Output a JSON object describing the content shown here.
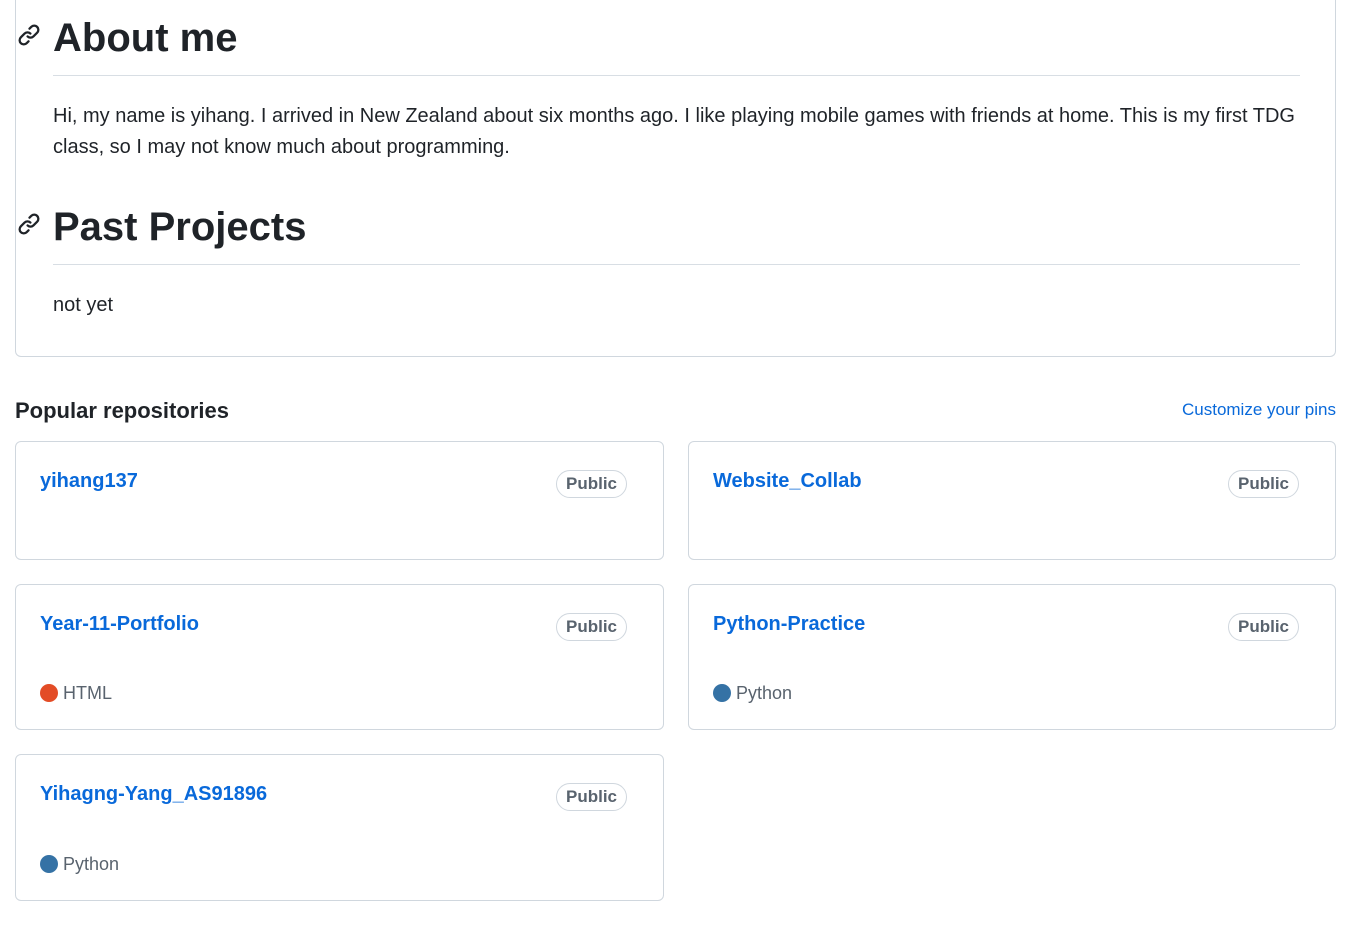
{
  "readme": {
    "about": {
      "heading": "About me",
      "text": "Hi, my name is yihang. I arrived in New Zealand about six months ago. I like playing mobile games with friends at home. This is my first TDG class, so I may not know much about programming."
    },
    "projects": {
      "heading": "Past Projects",
      "text": "not yet"
    }
  },
  "popular": {
    "title": "Popular repositories",
    "customize_label": "Customize your pins",
    "repos": [
      {
        "name": "yihang137",
        "visibility": "Public",
        "language": "",
        "language_color": ""
      },
      {
        "name": "Website_Collab",
        "visibility": "Public",
        "language": "",
        "language_color": ""
      },
      {
        "name": "Year-11-Portfolio",
        "visibility": "Public",
        "language": "HTML",
        "language_color": "#e34c26"
      },
      {
        "name": "Python-Practice",
        "visibility": "Public",
        "language": "Python",
        "language_color": "#3572A5"
      },
      {
        "name": "Yihagng-Yang_AS91896",
        "visibility": "Public",
        "language": "Python",
        "language_color": "#3572A5"
      }
    ]
  },
  "icons": {
    "anchor": "link-icon"
  }
}
